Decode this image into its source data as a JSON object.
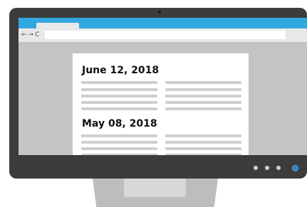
{
  "browser": {
    "nav_back": "←",
    "nav_forward": "→",
    "nav_reload": "C"
  },
  "page": {
    "entries": [
      {
        "date": "June 12, 2018"
      },
      {
        "date": "May 08, 2018"
      }
    ]
  },
  "monitor": {
    "controls": [
      "menu-button",
      "brightness-button",
      "volume-button"
    ],
    "power_icon": "power-icon"
  },
  "colors": {
    "bezel": "#3c3c3c",
    "tab_bar": "#32a8e0",
    "screen_bg": "#c4c4c4",
    "page_bg": "#ffffff",
    "text_line": "#cfcfcf",
    "power_button": "#2d7fc7",
    "stand": "#bdbdbd"
  }
}
